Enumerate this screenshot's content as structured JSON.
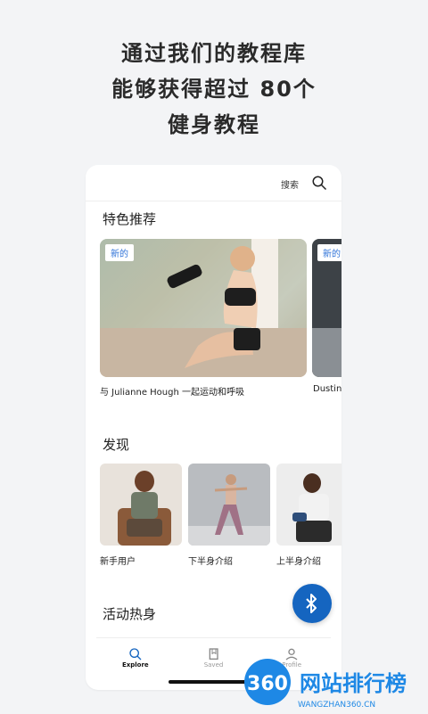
{
  "headline": {
    "line1": "通过我们的教程库",
    "line2": "能够获得超过 80个",
    "line3": "健身教程"
  },
  "topbar": {
    "search_label": "搜索"
  },
  "featured": {
    "title": "特色推荐",
    "badge": "新的",
    "cards": [
      {
        "caption": "与 Julianne Hough 一起运动和呼吸"
      },
      {
        "caption": "Dustin"
      }
    ]
  },
  "discover": {
    "title": "发现",
    "items": [
      {
        "label": "新手用户"
      },
      {
        "label": "下半身介绍"
      },
      {
        "label": "上半身介绍"
      }
    ]
  },
  "warmup": {
    "title": "活动热身"
  },
  "bottom_nav": {
    "items": [
      {
        "label": "Explore",
        "icon": "search-icon",
        "active": true
      },
      {
        "label": "Saved",
        "icon": "bookmark-icon",
        "active": false
      },
      {
        "label": "Profile",
        "icon": "person-icon",
        "active": false
      }
    ]
  },
  "watermark": {
    "text": "网站排行榜",
    "sub": "WANGZHAN360.CN",
    "logo": "360"
  },
  "colors": {
    "accent": "#1565c0",
    "badge_text": "#2f73d8"
  }
}
